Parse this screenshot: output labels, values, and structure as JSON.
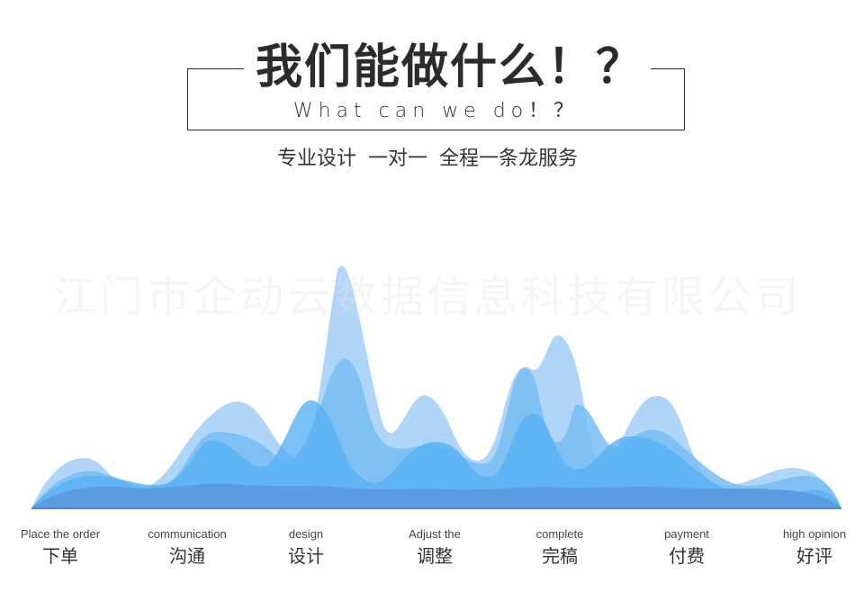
{
  "header": {
    "title": "我们能做什么！？",
    "subtitle_en": "What can we do！？",
    "tagline": "专业设计  一对一  全程一条龙服务"
  },
  "watermark": "江门市企动云数据信息科技有限公司",
  "colors": {
    "wave_light": "#9fcdf5",
    "wave_mid": "#6fb8f2",
    "wave_bright": "#4eaef5",
    "wave_base": "#5b9be0",
    "text_dark": "#2b2b2b"
  },
  "steps": [
    {
      "en": "Place the order",
      "zh": "下单"
    },
    {
      "en": "communication",
      "zh": "沟通"
    },
    {
      "en": "design",
      "zh": "设计"
    },
    {
      "en": "Adjust the",
      "zh": "调整"
    },
    {
      "en": "complete",
      "zh": "完稿"
    },
    {
      "en": "payment",
      "zh": "付费"
    },
    {
      "en": "high opinion",
      "zh": "好评"
    }
  ]
}
